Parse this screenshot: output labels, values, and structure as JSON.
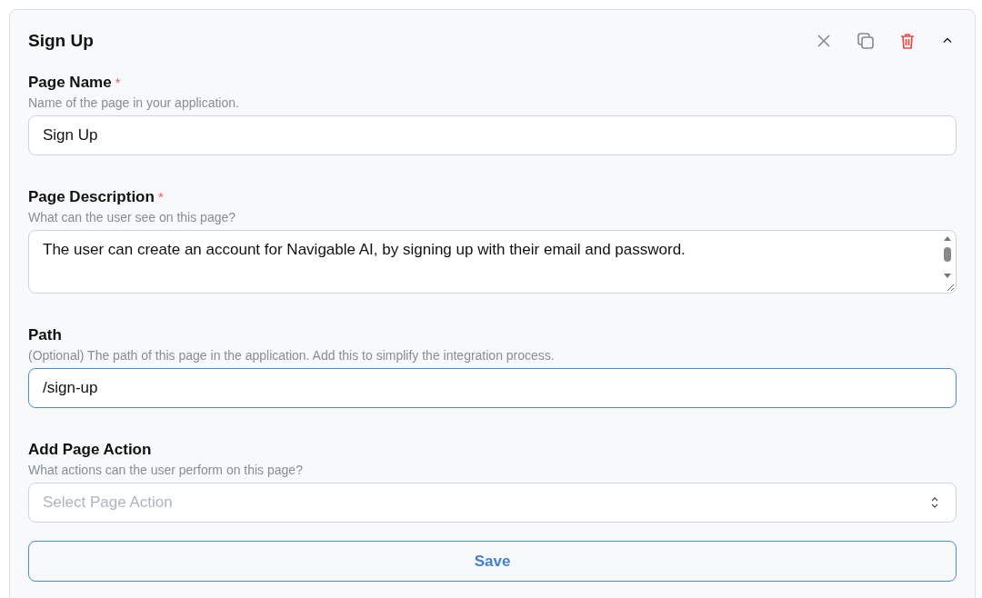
{
  "panel": {
    "title": "Sign Up",
    "expanded": true
  },
  "fields": [
    {
      "kind": "text",
      "label": "Page Name",
      "required": true,
      "hint": "Name of the page in your application.",
      "value": "Sign Up",
      "focused": false
    },
    {
      "kind": "textarea",
      "label": "Page Description",
      "required": true,
      "hint": "What can the user see on this page?",
      "value": "The user can create an account for Navigable AI, by signing up with their email and password.",
      "focused": false
    },
    {
      "kind": "text",
      "label": "Path",
      "required": false,
      "hint": "(Optional) The path of this page in the application. Add this to simplify the integration process.",
      "value": "/sign-up",
      "focused": true
    },
    {
      "kind": "select",
      "label": "Add Page Action",
      "required": false,
      "hint": "What actions can the user perform on this page?",
      "placeholder": "Select Page Action",
      "focused": false
    }
  ],
  "required_mark": "*",
  "save_button": "Save"
}
